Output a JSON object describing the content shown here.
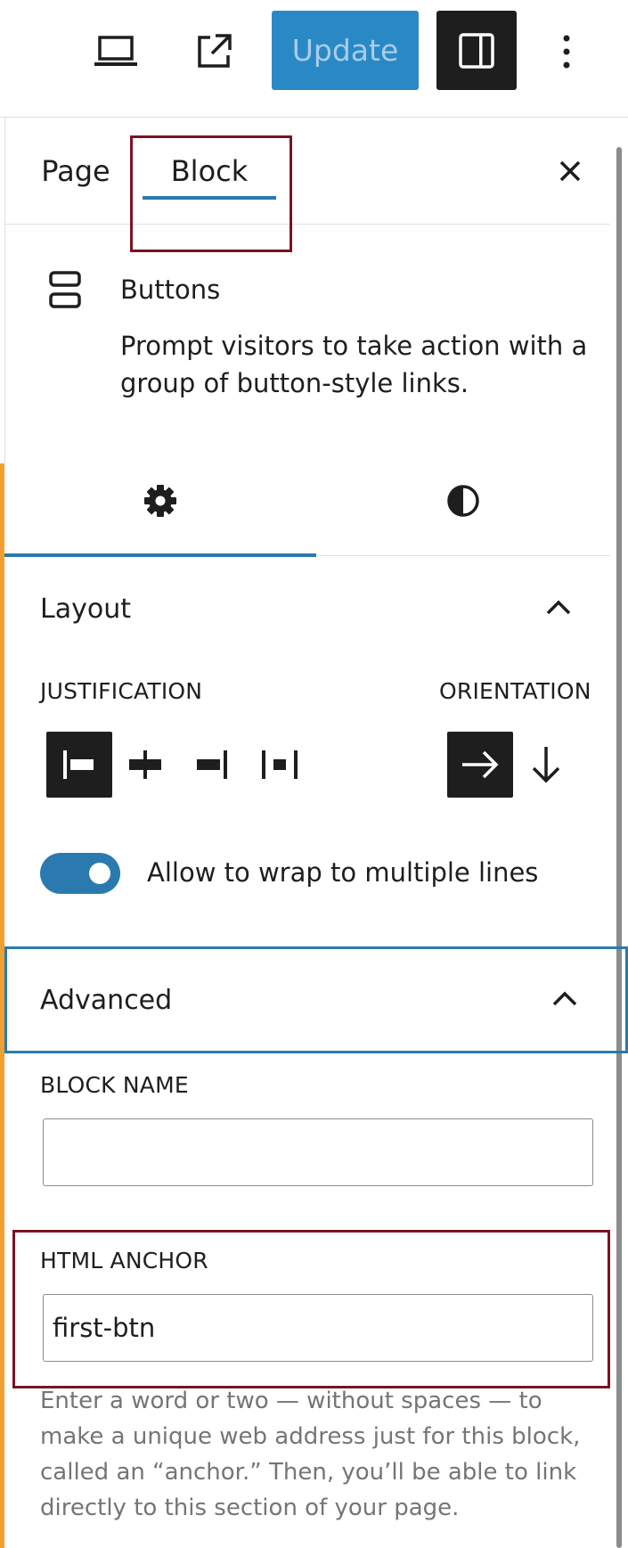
{
  "toolbar": {
    "preview_icon": "laptop-icon",
    "view_post_icon": "external-link-icon",
    "update_label": "Update",
    "settings_icon": "sidebar-toggle-icon",
    "more_icon": "more-vertical-icon"
  },
  "sidebar": {
    "tabs": [
      {
        "label": "Page"
      },
      {
        "label": "Block",
        "active": true
      }
    ],
    "close_icon": "close-icon"
  },
  "block_card": {
    "icon": "buttons-block-icon",
    "title": "Buttons",
    "description": "Prompt visitors to take action with a group of button-style links."
  },
  "inspector_tabs": [
    {
      "icon": "gear-icon",
      "active": true
    },
    {
      "icon": "contrast-icon",
      "active": false
    }
  ],
  "layout_panel": {
    "title": "Layout",
    "justification_label": "JUSTIFICATION",
    "justification_options": [
      {
        "icon": "justify-left-icon",
        "active": true
      },
      {
        "icon": "justify-center-icon",
        "active": false
      },
      {
        "icon": "justify-right-icon",
        "active": false
      },
      {
        "icon": "justify-space-between-icon",
        "active": false
      }
    ],
    "orientation_label": "ORIENTATION",
    "orientation_options": [
      {
        "icon": "arrow-right-icon",
        "active": true
      },
      {
        "icon": "arrow-down-icon",
        "active": false
      }
    ],
    "wrap_toggle": {
      "label": "Allow to wrap to multiple lines",
      "checked": true
    }
  },
  "advanced_panel": {
    "title": "Advanced",
    "block_name_label": "BLOCK NAME",
    "block_name_value": "",
    "html_anchor_label": "HTML ANCHOR",
    "html_anchor_value": "first-btn",
    "html_anchor_help": "Enter a word or two — without spaces — to make a unique web address just for this block, called an “anchor.” Then, you’ll be able to link directly to this section of your page."
  },
  "colors": {
    "accent": "#2a7ab0",
    "update_button": "#2a89c5",
    "highlight_annotation": "#7b1224",
    "left_edge_marker": "#f0a030"
  }
}
